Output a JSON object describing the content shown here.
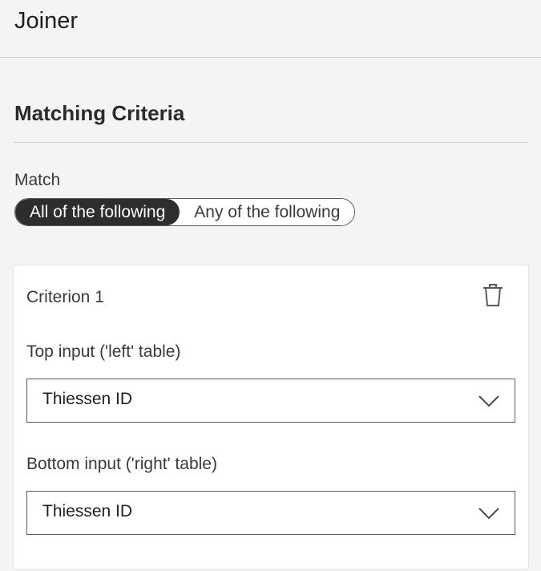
{
  "panel": {
    "title": "Joiner"
  },
  "matching": {
    "title": "Matching Criteria",
    "match_label": "Match",
    "options": [
      {
        "label": "All of the following",
        "selected": true
      },
      {
        "label": "Any of the following",
        "selected": false
      }
    ]
  },
  "criteria": [
    {
      "title": "Criterion 1",
      "delete_icon": "trash-icon",
      "top_input": {
        "label": "Top input ('left' table)",
        "value": "Thiessen ID"
      },
      "bottom_input": {
        "label": "Bottom input ('right' table)",
        "value": "Thiessen ID"
      }
    }
  ],
  "colors": {
    "background": "#f4f4f4",
    "card": "#ffffff",
    "active_segment": "#2d2d2d",
    "border": "#5a5a5a",
    "divider": "#c9c9c9"
  }
}
